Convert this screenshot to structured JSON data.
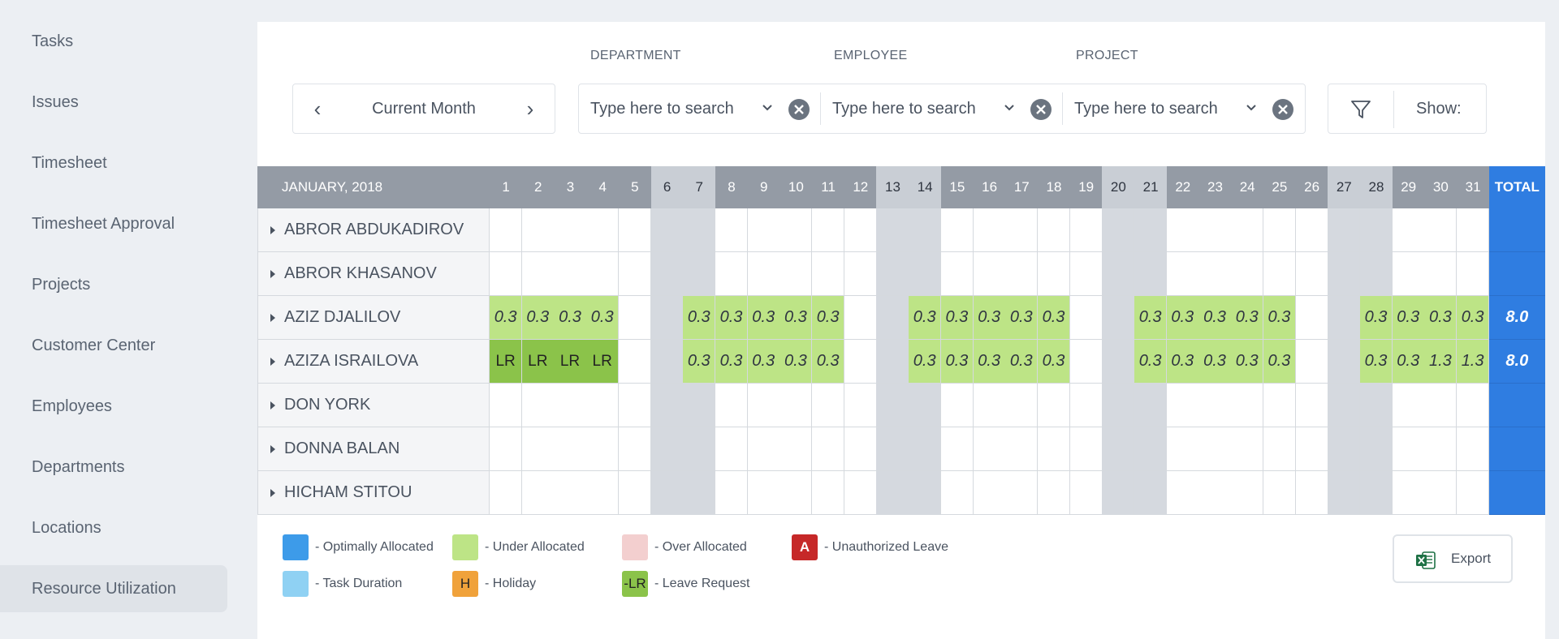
{
  "sidebar": {
    "items": [
      {
        "label": "Tasks",
        "active": false
      },
      {
        "label": "Issues",
        "active": false
      },
      {
        "label": "Timesheet",
        "active": false
      },
      {
        "label": "Timesheet Approval",
        "active": false
      },
      {
        "label": "Projects",
        "active": false
      },
      {
        "label": "Customer Center",
        "active": false
      },
      {
        "label": "Employees",
        "active": false
      },
      {
        "label": "Departments",
        "active": false
      },
      {
        "label": "Locations",
        "active": false
      },
      {
        "label": "Resource Utilization",
        "active": true
      }
    ]
  },
  "filters": {
    "period": "Current Month",
    "department": {
      "label": "DEPARTMENT",
      "placeholder": "Type here to search"
    },
    "employee": {
      "label": "EMPLOYEE",
      "placeholder": "Type here to search"
    },
    "project": {
      "label": "PROJECT",
      "placeholder": "Type here to search"
    },
    "show_label": "Show:"
  },
  "grid": {
    "title": "JANUARY, 2018",
    "total_label": "TOTAL",
    "days": [
      "1",
      "2",
      "3",
      "4",
      "5",
      "6",
      "7",
      "8",
      "9",
      "10",
      "11",
      "12",
      "13",
      "14",
      "15",
      "16",
      "17",
      "18",
      "19",
      "20",
      "21",
      "22",
      "23",
      "24",
      "25",
      "26",
      "27",
      "28",
      "29",
      "30",
      "31"
    ],
    "weekend_days": [
      6,
      13,
      20,
      27
    ],
    "employees": [
      {
        "name": "ABROR ABDUKADIROV",
        "cells": {},
        "total": ""
      },
      {
        "name": "ABROR KHASANOV",
        "cells": {},
        "total": ""
      },
      {
        "name": "AZIZ DJALILOV",
        "cells": {
          "1": "0.3",
          "2": "0.3",
          "3": "0.3",
          "4": "0.3",
          "7": "0.3",
          "8": "0.3",
          "9": "0.3",
          "10": "0.3",
          "11": "0.3",
          "14": "0.3",
          "15": "0.3",
          "16": "0.3",
          "17": "0.3",
          "18": "0.3",
          "21": "0.3",
          "22": "0.3",
          "23": "0.3",
          "24": "0.3",
          "25": "0.3",
          "28": "0.3",
          "29": "0.3",
          "30": "0.3",
          "31": "0.3"
        },
        "total": "8.0"
      },
      {
        "name": "AZIZA ISRAILOVA",
        "cells": {
          "1": "LR",
          "2": "LR",
          "3": "LR",
          "4": "LR",
          "7": "0.3",
          "8": "0.3",
          "9": "0.3",
          "10": "0.3",
          "11": "0.3",
          "14": "0.3",
          "15": "0.3",
          "16": "0.3",
          "17": "0.3",
          "18": "0.3",
          "21": "0.3",
          "22": "0.3",
          "23": "0.3",
          "24": "0.3",
          "25": "0.3",
          "28": "0.3",
          "29": "0.3",
          "30": "1.3",
          "31": "1.3"
        },
        "total": "8.0"
      },
      {
        "name": "DON YORK",
        "cells": {},
        "total": ""
      },
      {
        "name": "DONNA BALAN",
        "cells": {},
        "total": ""
      },
      {
        "name": "HICHAM STITOU",
        "cells": {},
        "total": ""
      }
    ]
  },
  "legend": [
    {
      "text": "- Optimally Allocated",
      "color": "#3d9be9",
      "glyph": ""
    },
    {
      "text": "- Under Allocated",
      "color": "#bde486",
      "glyph": ""
    },
    {
      "text": "- Over Allocated",
      "color": "#f3cfcf",
      "glyph": ""
    },
    {
      "text": "- Unauthorized Leave",
      "color": "#c62828",
      "glyph": "A"
    },
    {
      "text": "- Task Duration",
      "color": "#8fd1f3",
      "glyph": ""
    },
    {
      "text": "- Holiday",
      "color": "#f0a23b",
      "glyph": "H"
    },
    {
      "text": "- Leave Request",
      "color": "#8bc34a",
      "glyph": "-LR"
    }
  ],
  "export_label": "Export",
  "colors": {
    "header_grey": "#949ba5",
    "header_dark": "#8a919b",
    "header_weekend": "#c9ced5",
    "weekend_cell": "#d5d9df",
    "total_blue": "#2f7de1",
    "under_allocated": "#bde486",
    "leave_request": "#8bc34a"
  }
}
